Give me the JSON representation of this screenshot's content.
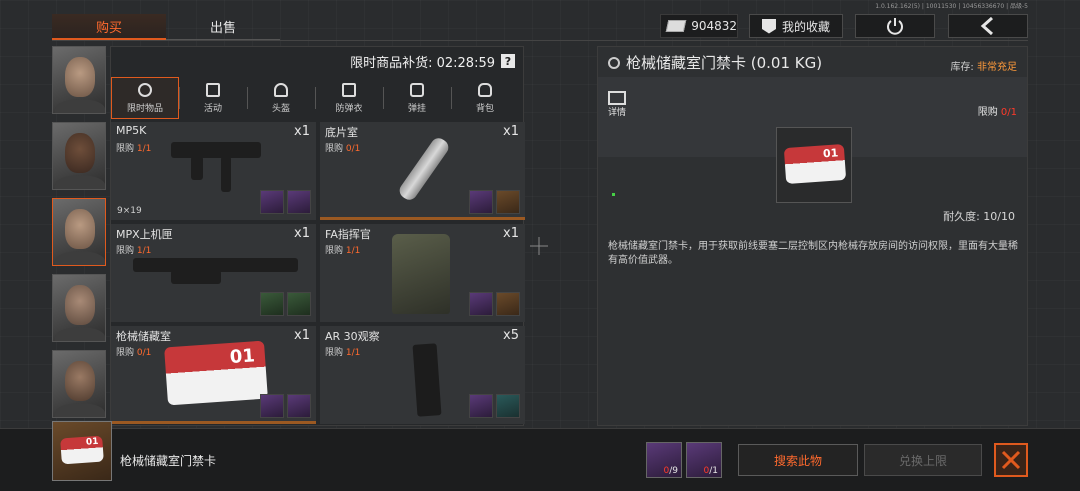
{
  "version": "1.0.162.162(5) | 10011530 | 10456336670 | 品级-5",
  "tabs": {
    "buy": "购买",
    "sell": "出售"
  },
  "currency": {
    "amount": "904832",
    "icon": "cash-icon"
  },
  "header_buttons": {
    "favorites": "我的收藏",
    "power_icon": "power-icon",
    "back_icon": "chevron-left-icon"
  },
  "shop": {
    "restock_label": "限时商品补货: 02:28:59",
    "help": "?",
    "categories": [
      {
        "label": "限时物品",
        "icon": "clock-icon"
      },
      {
        "label": "活动",
        "icon": "event-icon"
      },
      {
        "label": "头盔",
        "icon": "helmet-icon"
      },
      {
        "label": "防弹衣",
        "icon": "vest-icon"
      },
      {
        "label": "弹挂",
        "icon": "rig-icon"
      },
      {
        "label": "背包",
        "icon": "backpack-icon"
      }
    ],
    "items": [
      {
        "name": "MP5K",
        "limit_prefix": "限购 ",
        "limit": "1/1",
        "qty": "x1",
        "caliber": "9×19"
      },
      {
        "name": "底片室",
        "limit_prefix": "限购 ",
        "limit": "0/1",
        "qty": "x1",
        "caliber": ""
      },
      {
        "name": "MPX上机匣",
        "limit_prefix": "限购 ",
        "limit": "1/1",
        "qty": "x1",
        "caliber": ""
      },
      {
        "name": "FA指挥官",
        "limit_prefix": "限购 ",
        "limit": "1/1",
        "qty": "x1",
        "caliber": ""
      },
      {
        "name": "枪械储藏室",
        "limit_prefix": "限购 ",
        "limit": "0/1",
        "qty": "x1",
        "caliber": ""
      },
      {
        "name": "AR 30观察",
        "limit_prefix": "限购 ",
        "limit": "1/1",
        "qty": "x5",
        "caliber": ""
      }
    ]
  },
  "detail": {
    "title": "枪械储藏室门禁卡 (0.01 KG)",
    "stock_label": "库存: ",
    "stock_value": "非常充足",
    "info_label": "详情",
    "limit_label": "限购 ",
    "limit_value": "0/1",
    "keycard_number": "01",
    "durability": "耐久度: 10/10",
    "description": "枪械储藏室门禁卡，用于获取前线要塞二层控制区内枪械存放房间的访问权限，里面有大量稀有高价值武器。"
  },
  "bottom": {
    "item_name": "枪械储藏室门禁卡",
    "requirements": [
      {
        "have": "0",
        "need": "/9"
      },
      {
        "have": "0",
        "need": "/1"
      }
    ],
    "search_button": "搜索此物",
    "exchange_button": "兑换上限",
    "close_icon": "close-icon"
  },
  "colors": {
    "accent": "#e05a1e",
    "limit_red": "#ff3a2a",
    "stock_orange": "#ff9a3a"
  }
}
